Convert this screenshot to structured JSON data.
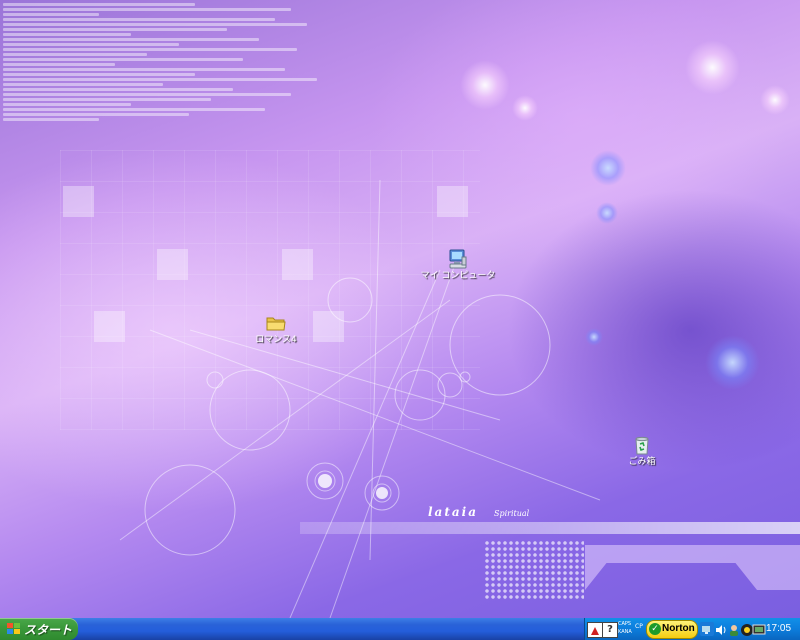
{
  "desktop": {
    "icons": [
      {
        "label": "マイ コンピュータ",
        "icon": "my-computer-icon"
      },
      {
        "label": "ロマンス4",
        "icon": "folder-icon"
      },
      {
        "label": "ごみ箱",
        "icon": "recycle-bin-icon"
      }
    ],
    "wallpaper": {
      "brand": "lataia",
      "subtitle": "Spiritual",
      "colors": {
        "base": "#b58af0",
        "light": "#d9b1f6",
        "deep": "#7a5fe0"
      }
    }
  },
  "taskbar": {
    "start_label": "スタート",
    "start_color": "#3c9a3c",
    "bar_color": "#245edb",
    "tray": {
      "ime_line1": "CAPS",
      "ime_line2": "KANA",
      "ime_mode": "CP",
      "norton_label": "Norton",
      "clock": "17:05",
      "icons": [
        "acrobat-icon",
        "help-icon",
        "norton-icon",
        "network-icon",
        "volume-icon",
        "user-icon",
        "antivirus-icon",
        "display-icon"
      ]
    }
  }
}
